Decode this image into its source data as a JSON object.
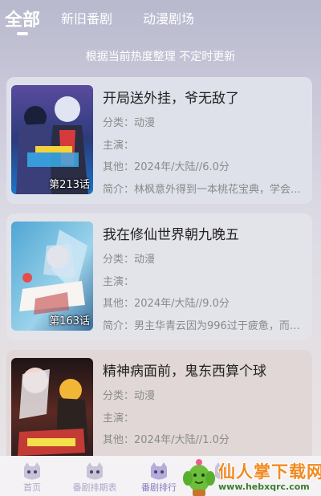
{
  "tabs": [
    {
      "label": "全部",
      "active": true
    },
    {
      "label": "新旧番剧",
      "active": false
    },
    {
      "label": "动漫剧场",
      "active": false
    }
  ],
  "notice": "根据当前热度整理 不定时更新",
  "items": [
    {
      "title": "开局送外挂，爷无敌了",
      "category": "分类：动漫",
      "cast": "主演：",
      "other": "其他：2024年/大陆//6.0分",
      "summary": "简介：林枫意外得到一本桃花宝典，学会了……",
      "episode": "第213话"
    },
    {
      "title": "我在修仙世界朝九晚五",
      "category": "分类：动漫",
      "cast": "主演：",
      "other": "其他：2024年/大陆//9.0分",
      "summary": "简介：男主华青云因为996过于疲惫，而穿越……",
      "episode": "第163话"
    },
    {
      "title": "精神病面前，鬼东西算个球",
      "category": "分类：动漫",
      "cast": "主演：",
      "other": "其他：2024年/大陆//1.0分",
      "summary": "",
      "episode": ""
    }
  ],
  "bottom_nav": [
    {
      "label": "首页",
      "icon": "mascot-home-icon"
    },
    {
      "label": "番剧排期表",
      "icon": "mascot-schedule-icon"
    },
    {
      "label": "番剧排行",
      "icon": "mascot-ranking-icon",
      "active": true
    },
    {
      "label": "",
      "icon": "mascot-icon"
    }
  ],
  "watermark": {
    "name": "仙人掌下载网",
    "url": "www.hebxqrc.com"
  },
  "colors": {
    "accent": "#8a7bc0",
    "watermark_orange": "#f08a1f",
    "watermark_green": "#3a7d2e"
  }
}
